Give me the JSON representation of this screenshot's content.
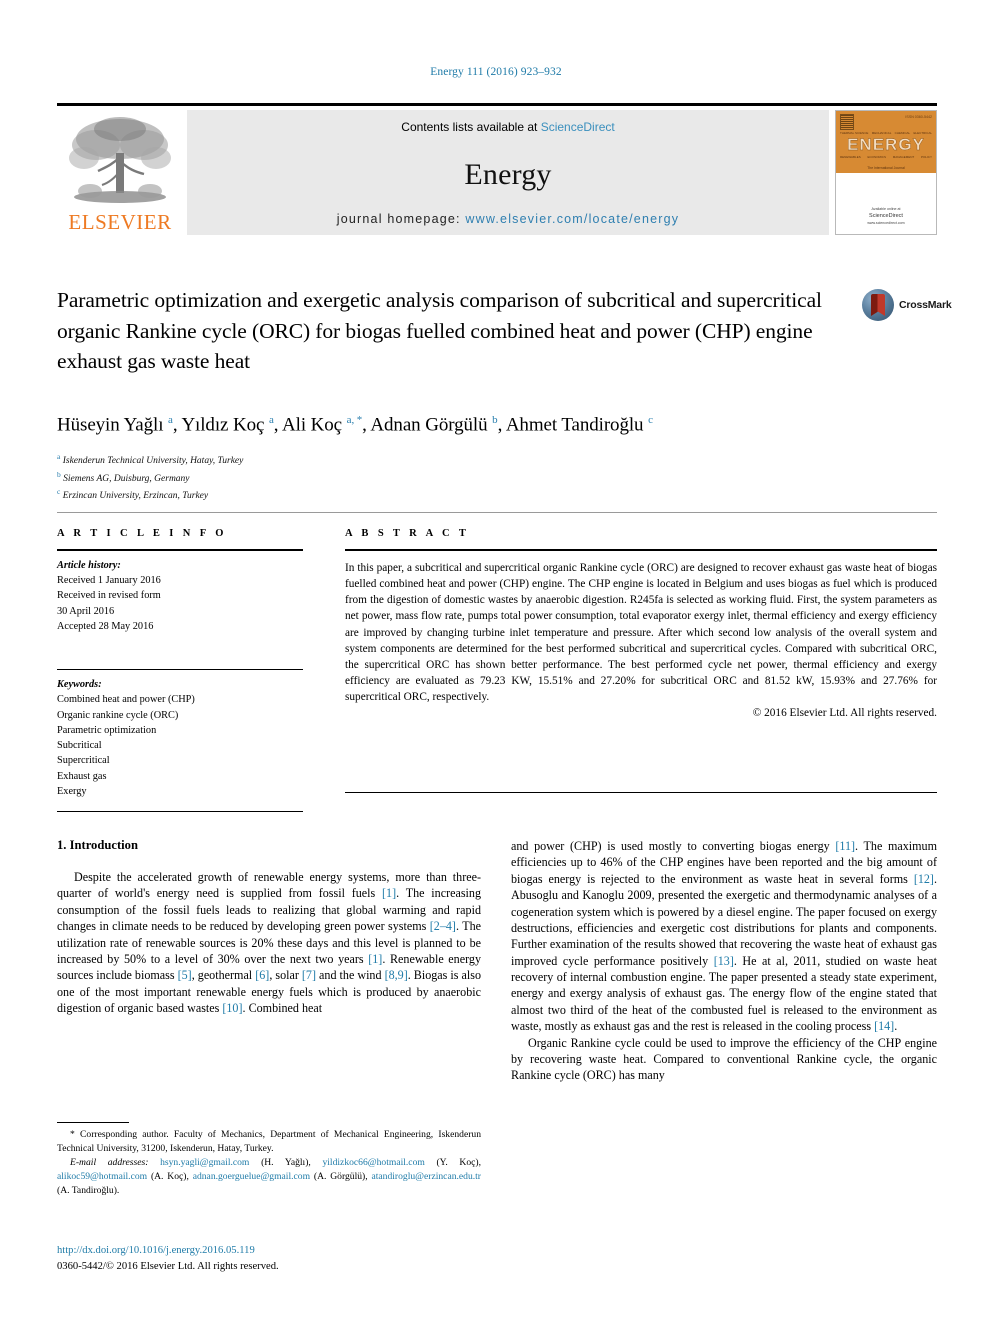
{
  "running_head": "Energy 111 (2016) 923–932",
  "banner": {
    "publisher": "ELSEVIER",
    "contents_prefix": "Contents lists available at ",
    "contents_link": "ScienceDirect",
    "journal_title": "Energy",
    "homepage_prefix": "journal homepage: ",
    "homepage_url": "www.elsevier.com/locate/energy",
    "cover": {
      "issue_label": "ISSN 0360-5442",
      "title": "ENERGY",
      "tagline": "The International Journal",
      "row1": [
        "THERMAL SCIENCE",
        "MECHANICAL",
        "CHEMICAL",
        "ELECTRICAL"
      ],
      "row2": [
        "RENEWABLES",
        "ECONOMICS",
        "MANAGEMENT",
        "POLICY"
      ],
      "publisher_small": "Available online at",
      "publisher_name": "ScienceDirect",
      "publisher_sub": "www.sciencedirect.com"
    }
  },
  "article": {
    "title": "Parametric optimization and exergetic analysis comparison of subcritical and supercritical organic Rankine cycle (ORC) for biogas fuelled combined heat and power (CHP) engine exhaust gas waste heat",
    "crossmark_label": "CrossMark",
    "authors_html": "Hüseyin Yağlı <sup>a</sup>, Yıldız Koç <sup>a</sup>, Ali Koç <sup>a, *</sup>, Adnan Görgülü <sup>b</sup>, Ahmet Tandiroğlu <sup>c</sup>",
    "affiliations": [
      {
        "mark": "a",
        "text": "Iskenderun Technical University, Hatay, Turkey"
      },
      {
        "mark": "b",
        "text": "Siemens AG, Duisburg, Germany"
      },
      {
        "mark": "c",
        "text": "Erzincan University, Erzincan, Turkey"
      }
    ]
  },
  "article_info": {
    "heading": "A R T I C L E   I N F O",
    "history_label": "Article history:",
    "history": [
      "Received 1 January 2016",
      "Received in revised form",
      "30 April 2016",
      "Accepted 28 May 2016"
    ],
    "keywords_label": "Keywords:",
    "keywords": [
      "Combined heat and power (CHP)",
      "Organic rankine cycle (ORC)",
      "Parametric optimization",
      "Subcritical",
      "Supercritical",
      "Exhaust gas",
      "Exergy"
    ]
  },
  "abstract": {
    "heading": "A B S T R A C T",
    "text": "In this paper, a subcritical and supercritical organic Rankine cycle (ORC) are designed to recover exhaust gas waste heat of biogas fuelled combined heat and power (CHP) engine. The CHP engine is located in Belgium and uses biogas as fuel which is produced from the digestion of domestic wastes by anaerobic digestion. R245fa is selected as working fluid. First, the system parameters as net power, mass flow rate, pumps total power consumption, total evaporator exergy inlet, thermal efficiency and exergy efficiency are improved by changing turbine inlet temperature and pressure. After which second low analysis of the overall system and system components are determined for the best performed subcritical and supercritical cycles. Compared with subcritical ORC, the supercritical ORC has shown better performance. The best performed cycle net power, thermal efficiency and exergy efficiency are evaluated as 79.23 KW, 15.51% and 27.20% for subcritical ORC and 81.52 kW, 15.93% and 27.76% for supercritical ORC, respectively.",
    "copyright": "© 2016 Elsevier Ltd. All rights reserved."
  },
  "introduction": {
    "heading": "1. Introduction",
    "left_paragraphs": [
      "Despite the accelerated growth of renewable energy systems, more than three-quarter of world's energy need is supplied from fossil fuels [1]. The increasing consumption of the fossil fuels leads to realizing that global warming and rapid changes in climate needs to be reduced by developing green power systems [2–4]. The utilization rate of renewable sources is 20% these days and this level is planned to be increased by 50% to a level of 30% over the next two years [1]. Renewable energy sources include biomass [5], geothermal [6], solar [7] and the wind [8,9]. Biogas is also one of the most important renewable energy fuels which is produced by anaerobic digestion of organic based wastes [10]. Combined heat"
    ],
    "right_paragraphs": [
      "and power (CHP) is used mostly to converting biogas energy [11]. The maximum efficiencies up to 46% of the CHP engines have been reported and the big amount of biogas energy is rejected to the environment as waste heat in several forms [12]. Abusoglu and Kanoglu 2009, presented the exergetic and thermodynamic analyses of a cogeneration system which is powered by a diesel engine. The paper focused on exergy destructions, efficiencies and exergetic cost distributions for plants and components. Further examination of the results showed that recovering the waste heat of exhaust gas improved cycle performance positively [13]. He at al, 2011, studied on waste heat recovery of internal combustion engine. The paper presented a steady state experiment, energy and exergy analysis of exhaust gas. The energy flow of the engine stated that almost two third of the heat of the combusted fuel is released to the environment as waste, mostly as exhaust gas and the rest is released in the cooling process [14].",
      "Organic Rankine cycle could be used to improve the efficiency of the CHP engine by recovering waste heat. Compared to conventional Rankine cycle, the organic Rankine cycle (ORC) has many"
    ]
  },
  "footnote": {
    "corresponding": "* Corresponding author. Faculty of Mechanics, Department of Mechanical Engineering, Iskenderun Technical University, 31200, Iskenderun, Hatay, Turkey.",
    "email_label": "E-mail addresses:",
    "emails": [
      {
        "address": "hsyn.yagli@gmail.com",
        "owner": "(H. Yağlı)"
      },
      {
        "address": "yildizkoc66@hotmail.com",
        "owner": "(Y. Koç)"
      },
      {
        "address": "alikoc59@hotmail.com",
        "owner": "(A. Koç)"
      },
      {
        "address": "adnan.goerguelue@gmail.com",
        "owner": "(A. Görgülü)"
      },
      {
        "address": "atandiroglu@erzincan.edu.tr",
        "owner": "(A. Tandiroğlu)"
      }
    ]
  },
  "imprint": {
    "doi": "http://dx.doi.org/10.1016/j.energy.2016.05.119",
    "issn_line": "0360-5442/© 2016 Elsevier Ltd. All rights reserved."
  },
  "colors": {
    "link": "#1f7ba8",
    "elsevier_orange": "#EE7A23",
    "banner_grey": "#e9e9e9",
    "cover_orange": "#d78a33"
  }
}
